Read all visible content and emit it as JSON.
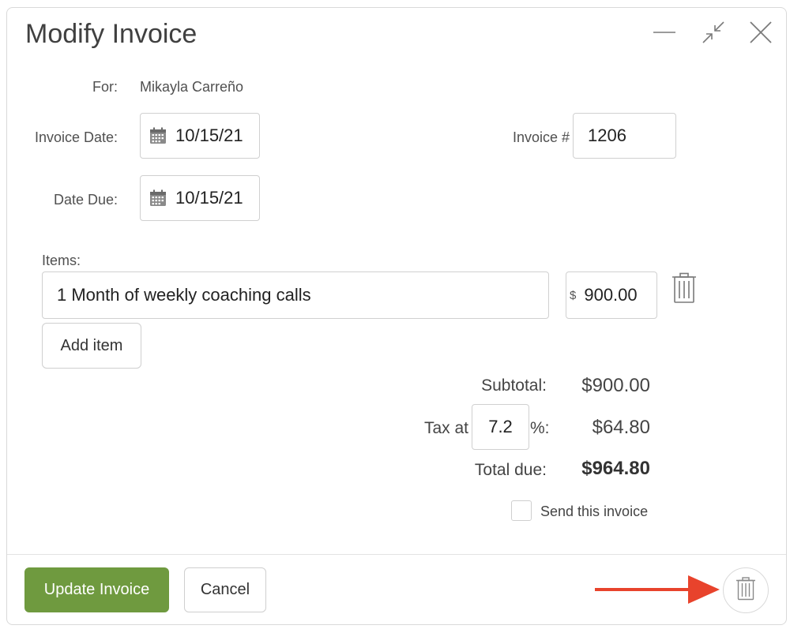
{
  "dialog": {
    "title": "Modify Invoice",
    "controls": {
      "minimize": "minimize-icon",
      "collapse": "collapse-icon",
      "close": "close-icon"
    }
  },
  "form": {
    "for_label": "For:",
    "for_value": "Mikayla Carreño",
    "invoice_date_label": "Invoice Date:",
    "invoice_date_value": "10/15/21",
    "date_due_label": "Date Due:",
    "date_due_value": "10/15/21",
    "invoice_number_label": "Invoice #",
    "invoice_number_value": "1206"
  },
  "items": {
    "label": "Items:",
    "list": [
      {
        "description": "1 Month of weekly coaching calls",
        "currency": "$",
        "amount": "900.00"
      }
    ],
    "add_label": "Add item"
  },
  "summary": {
    "subtotal_label": "Subtotal:",
    "subtotal_value": "$900.00",
    "tax_label": "Tax at",
    "tax_rate": "7.2",
    "tax_suffix": "%:",
    "tax_value": "$64.80",
    "total_label": "Total due:",
    "total_value": "$964.80"
  },
  "send": {
    "label": "Send this invoice",
    "checked": false
  },
  "footer": {
    "update_label": "Update Invoice",
    "cancel_label": "Cancel",
    "delete_icon": "trash-icon"
  },
  "colors": {
    "primary": "#6f9a3f",
    "arrow": "#e8432c",
    "border": "#d0d0d0"
  }
}
